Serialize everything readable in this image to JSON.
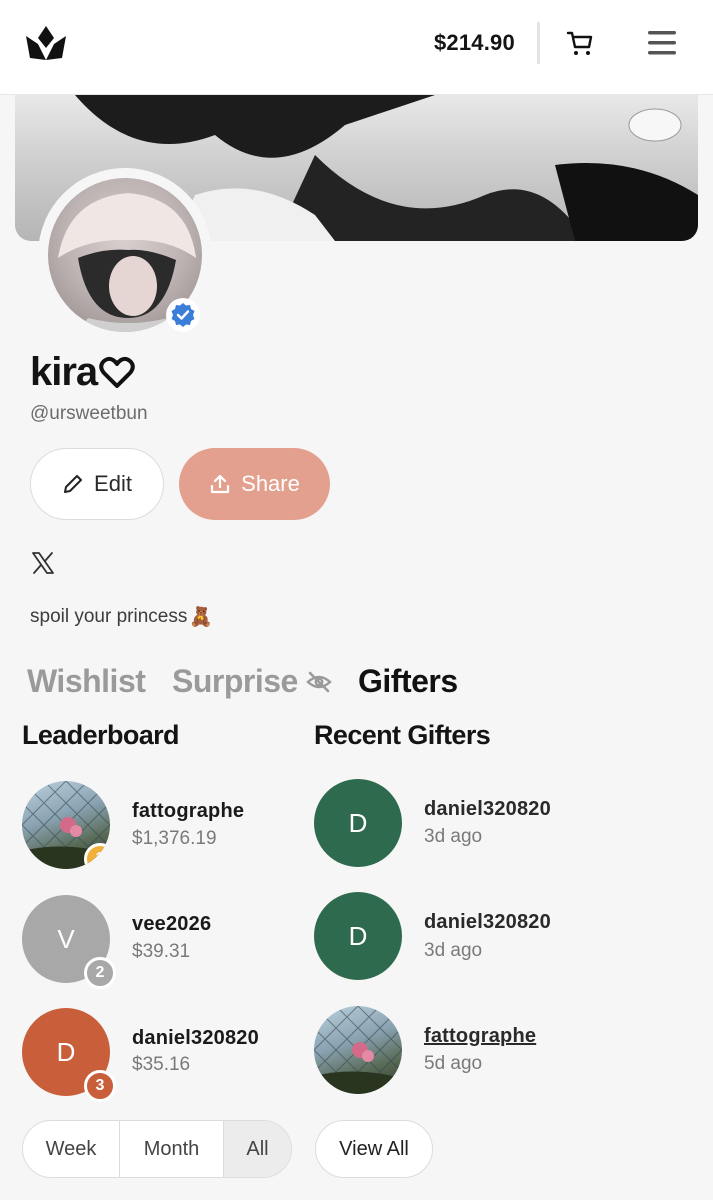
{
  "header": {
    "logo_icon": "crown-logo-icon",
    "balance": "$214.90",
    "cart_icon": "cart-icon",
    "menu_icon": "hamburger-menu-icon"
  },
  "profile": {
    "name": "kira",
    "name_suffix_icon": "heart-outline-icon",
    "handle": "@ursweetbun",
    "verified_icon": "verified-badge-icon",
    "edit_label": "Edit",
    "share_label": "Share",
    "social_icon": "x-logo-icon",
    "bio": "spoil your princess",
    "bio_emoji": "🧸"
  },
  "tabs": [
    {
      "label": "Wishlist",
      "active": false
    },
    {
      "label": "Surprise",
      "active": false,
      "icon": "eye-off-icon"
    },
    {
      "label": "Gifters",
      "active": true
    }
  ],
  "leaderboard": {
    "title": "Leaderboard",
    "entries": [
      {
        "rank": "1",
        "name": "fattographe",
        "amount": "$1,376.19",
        "avatar_type": "photo",
        "rank_color": "#f0b03a"
      },
      {
        "rank": "2",
        "name": "vee2026",
        "amount": "$39.31",
        "initial": "V",
        "avatar_color": "#a8a8a8",
        "rank_color": "#a8a8a8"
      },
      {
        "rank": "3",
        "name": "daniel320820",
        "amount": "$35.16",
        "initial": "D",
        "avatar_color": "#c85e3a",
        "rank_color": "#c85e3a"
      }
    ],
    "filters": [
      "Week",
      "Month",
      "All"
    ],
    "selected_filter": "All"
  },
  "recent": {
    "title": "Recent Gifters",
    "entries": [
      {
        "name": "daniel320820",
        "time": "3d ago",
        "initial": "D",
        "avatar_color": "#2e6b4e"
      },
      {
        "name": "daniel320820",
        "time": "3d ago",
        "initial": "D",
        "avatar_color": "#2e6b4e"
      },
      {
        "name": "fattographe",
        "time": "5d ago",
        "avatar_type": "photo",
        "underlined": true
      }
    ],
    "view_all_label": "View All"
  },
  "colors": {
    "share_button": "#e4a08e",
    "verified_blue": "#3b7ed8"
  }
}
